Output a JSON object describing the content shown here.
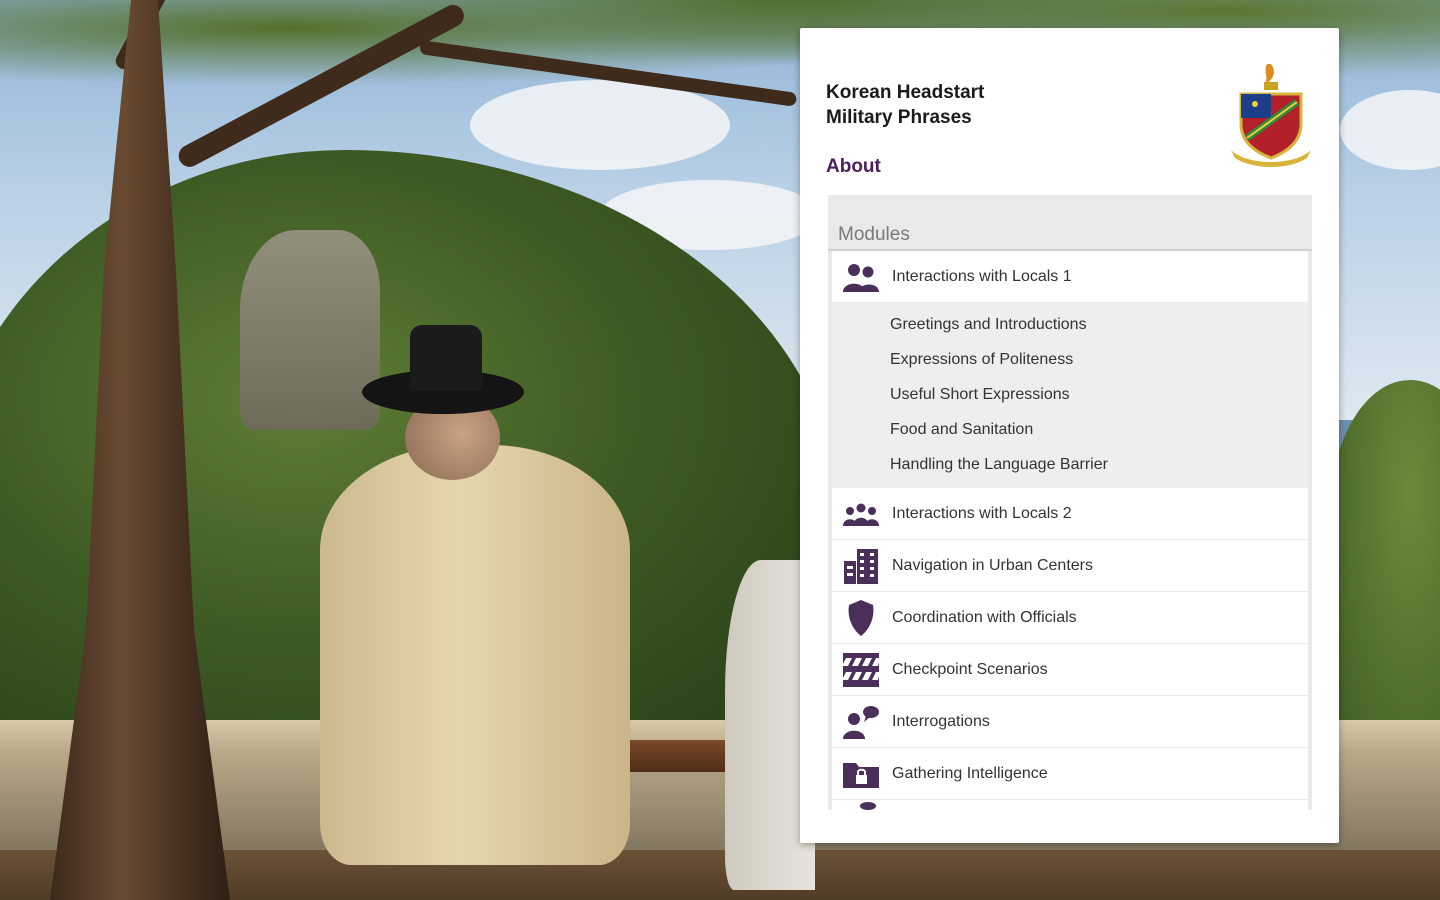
{
  "app": {
    "title_line1": "Korean Headstart",
    "title_line2": "Military Phrases",
    "about_label": "About"
  },
  "modules": {
    "header": "Modules",
    "items": [
      {
        "label": "Interactions with Locals 1",
        "icon": "two-people-icon",
        "expanded": true,
        "subitems": [
          "Greetings and Introductions",
          "Expressions of Politeness",
          "Useful Short Expressions",
          "Food and Sanitation",
          "Handling the Language Barrier"
        ]
      },
      {
        "label": "Interactions with Locals 2",
        "icon": "group-people-icon"
      },
      {
        "label": "Navigation in Urban Centers",
        "icon": "buildings-icon"
      },
      {
        "label": "Coordination with Officials",
        "icon": "badge-shield-icon"
      },
      {
        "label": "Checkpoint Scenarios",
        "icon": "checkpoint-barrier-icon"
      },
      {
        "label": "Interrogations",
        "icon": "person-speech-icon"
      },
      {
        "label": "Gathering Intelligence",
        "icon": "locked-folder-icon"
      }
    ]
  },
  "colors": {
    "icon": "#4a2f5a",
    "about": "#4a1f5c",
    "panel_bg": "#ffffff",
    "list_bg": "#e9e9e9"
  }
}
